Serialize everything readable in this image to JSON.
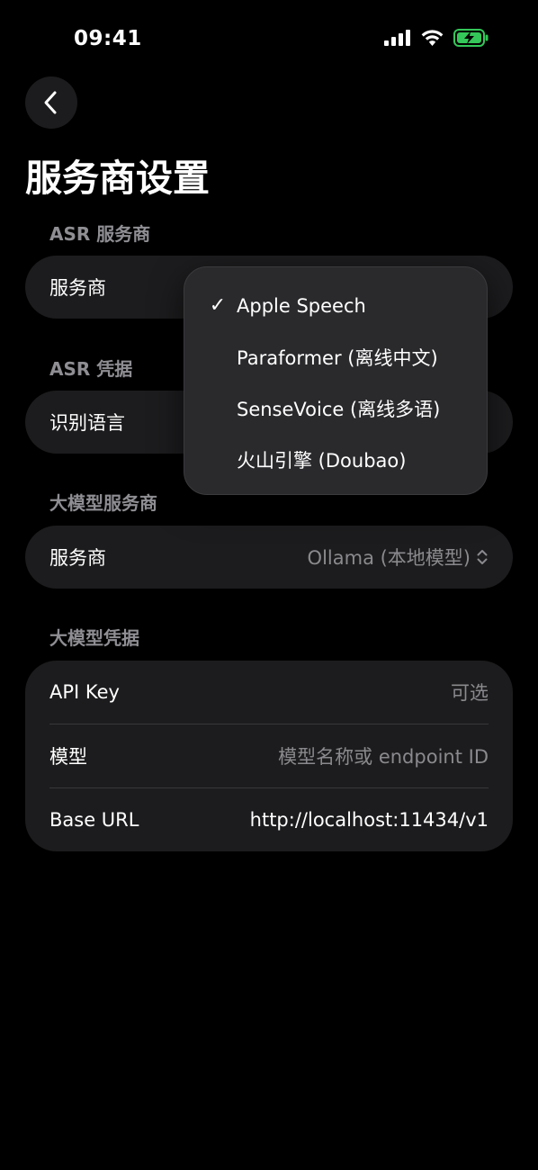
{
  "status_bar": {
    "time": "09:41"
  },
  "page_title": "服务商设置",
  "asr_provider_section": {
    "label": "ASR 服务商",
    "row_label": "服务商"
  },
  "asr_credentials_section": {
    "label": "ASR 凭据",
    "row_label": "识别语言"
  },
  "asr_menu": {
    "items": [
      {
        "label": "Apple Speech",
        "checked": true
      },
      {
        "label": "Paraformer (离线中文)",
        "checked": false
      },
      {
        "label": "SenseVoice (离线多语)",
        "checked": false
      },
      {
        "label": "火山引擎 (Doubao)",
        "checked": false
      }
    ]
  },
  "llm_provider_section": {
    "label": "大模型服务商",
    "row_label": "服务商",
    "value": "Ollama (本地模型)"
  },
  "llm_credentials_section": {
    "label": "大模型凭据",
    "api_key": {
      "label": "API Key",
      "placeholder": "可选"
    },
    "model": {
      "label": "模型",
      "placeholder": "模型名称或 endpoint ID"
    },
    "base_url": {
      "label": "Base URL",
      "value": "http://localhost:11434/v1"
    }
  }
}
